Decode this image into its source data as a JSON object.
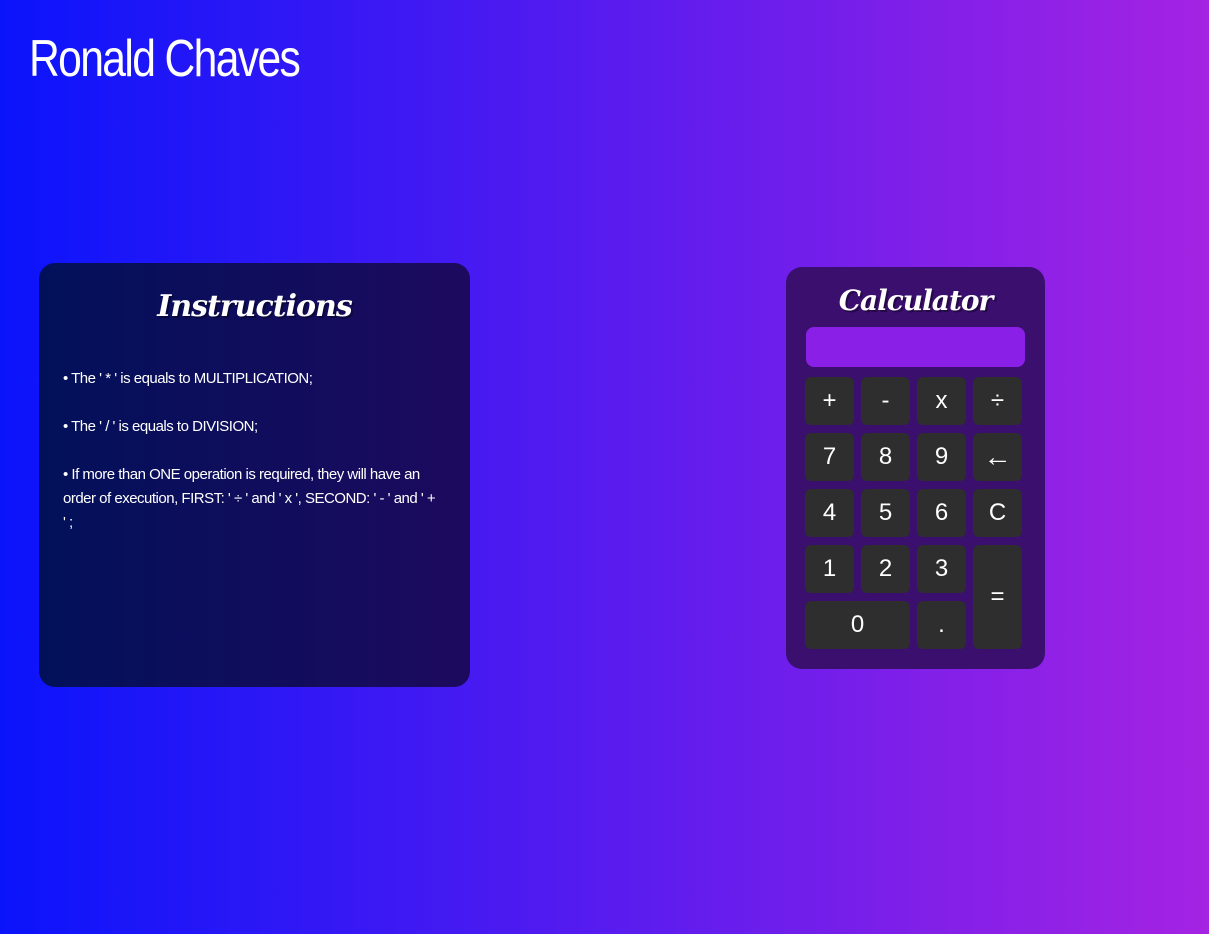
{
  "page": {
    "title": "Ronald Chaves",
    "colors": {
      "background_gradient_start": "#0a14fb",
      "background_gradient_end": "#a523e3",
      "instructions_panel_start": "#02105a",
      "instructions_panel_end": "#1d0a5e",
      "calculator_panel": "#3a0f6e",
      "display": "#8a20e8",
      "key": "#2e2e2e"
    }
  },
  "instructions": {
    "title": "Instructions",
    "items": [
      "• The ' * ' is equals to MULTIPLICATION;",
      "• The ' / ' is equals to DIVISION;",
      "• If more than ONE operation is required, they will have an order of execution, FIRST: ' ÷ ' and ' x ', SECOND: ' - ' and ' + ' ;"
    ]
  },
  "calculator": {
    "title": "Calculator",
    "display_value": "",
    "keys": {
      "plus": "+",
      "minus": "-",
      "multiply": "x",
      "divide": "÷",
      "seven": "7",
      "eight": "8",
      "nine": "9",
      "backspace": "←",
      "four": "4",
      "five": "5",
      "six": "6",
      "clear": "C",
      "one": "1",
      "two": "2",
      "three": "3",
      "equals": "=",
      "zero": "0",
      "decimal": "."
    }
  }
}
